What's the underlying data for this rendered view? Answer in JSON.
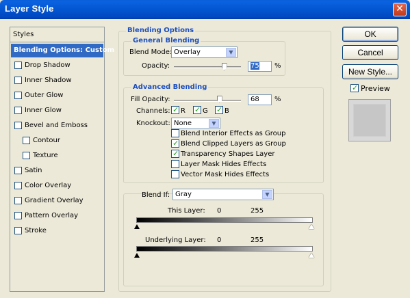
{
  "window": {
    "title": "Layer Style",
    "close_glyph": "✕"
  },
  "styles_panel": {
    "header": "Styles",
    "items": [
      {
        "label": "Blending Options: Custom",
        "active": true,
        "checkbox": false,
        "sub": false,
        "checked": false
      },
      {
        "label": "Drop Shadow",
        "active": false,
        "checkbox": true,
        "sub": false,
        "checked": false
      },
      {
        "label": "Inner Shadow",
        "active": false,
        "checkbox": true,
        "sub": false,
        "checked": false
      },
      {
        "label": "Outer Glow",
        "active": false,
        "checkbox": true,
        "sub": false,
        "checked": false
      },
      {
        "label": "Inner Glow",
        "active": false,
        "checkbox": true,
        "sub": false,
        "checked": false
      },
      {
        "label": "Bevel and Emboss",
        "active": false,
        "checkbox": true,
        "sub": false,
        "checked": false
      },
      {
        "label": "Contour",
        "active": false,
        "checkbox": true,
        "sub": true,
        "checked": false
      },
      {
        "label": "Texture",
        "active": false,
        "checkbox": true,
        "sub": true,
        "checked": false
      },
      {
        "label": "Satin",
        "active": false,
        "checkbox": true,
        "sub": false,
        "checked": false
      },
      {
        "label": "Color Overlay",
        "active": false,
        "checkbox": true,
        "sub": false,
        "checked": false
      },
      {
        "label": "Gradient Overlay",
        "active": false,
        "checkbox": true,
        "sub": false,
        "checked": false
      },
      {
        "label": "Pattern Overlay",
        "active": false,
        "checkbox": true,
        "sub": false,
        "checked": false
      },
      {
        "label": "Stroke",
        "active": false,
        "checkbox": true,
        "sub": false,
        "checked": false
      }
    ]
  },
  "blending_options": {
    "title": "Blending Options",
    "general": {
      "title": "General Blending",
      "blend_mode_label": "Blend Mode:",
      "blend_mode_value": "Overlay",
      "opacity_label": "Opacity:",
      "opacity_value": "75",
      "opacity_unit": "%",
      "opacity_level": 0.75
    },
    "advanced": {
      "title": "Advanced Blending",
      "fill_opacity_label": "Fill Opacity:",
      "fill_opacity_value": "68",
      "fill_opacity_unit": "%",
      "fill_opacity_level": 0.68,
      "channels_label": "Channels:",
      "channels": [
        {
          "label": "R",
          "checked": true
        },
        {
          "label": "G",
          "checked": true
        },
        {
          "label": "B",
          "checked": true
        }
      ],
      "knockout_label": "Knockout:",
      "knockout_value": "None",
      "options": [
        {
          "label": "Blend Interior Effects as Group",
          "checked": false
        },
        {
          "label": "Blend Clipped Layers as Group",
          "checked": true
        },
        {
          "label": "Transparency Shapes Layer",
          "checked": true
        },
        {
          "label": "Layer Mask Hides Effects",
          "checked": false
        },
        {
          "label": "Vector Mask Hides Effects",
          "checked": false
        }
      ]
    },
    "blend_if": {
      "label": "Blend If:",
      "value": "Gray",
      "this_layer_label": "This Layer:",
      "this_layer_min": "0",
      "this_layer_max": "255",
      "underlying_label": "Underlying Layer:",
      "underlying_min": "0",
      "underlying_max": "255"
    }
  },
  "buttons": {
    "ok": "OK",
    "cancel": "Cancel",
    "new_style": "New Style..."
  },
  "preview": {
    "label": "Preview",
    "checked": true
  },
  "colors": {
    "title_bar": "#0355d0",
    "selection": "#316ac5",
    "group_title": "#1c4fbf"
  }
}
